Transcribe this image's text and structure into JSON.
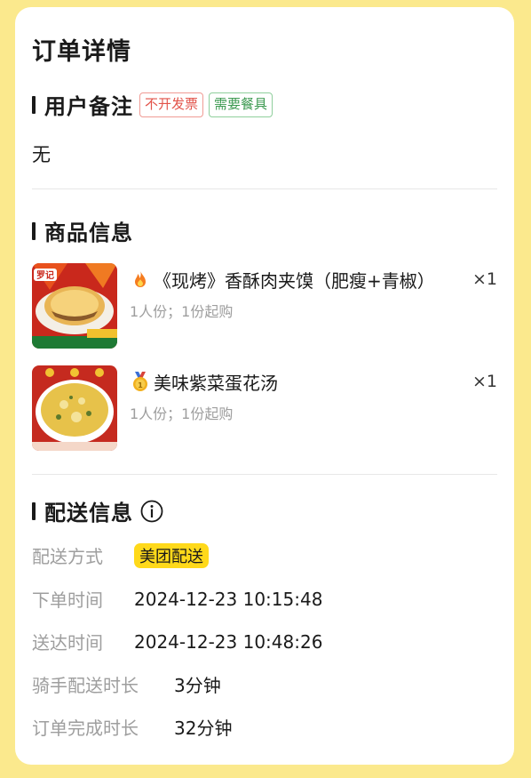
{
  "page": {
    "title": "订单详情"
  },
  "remark_section": {
    "title": "用户备注",
    "tags": [
      {
        "label": "不开发票",
        "color": "#e2534a"
      },
      {
        "label": "需要餐具",
        "color": "#3d9a51"
      }
    ],
    "content": "无"
  },
  "goods_section": {
    "title": "商品信息",
    "items": [
      {
        "icon": "fire-icon",
        "name": "《现烤》香酥肉夹馍（肥瘦+青椒）",
        "desc": "1人份；1份起购",
        "qty": "×1"
      },
      {
        "icon": "medal-icon",
        "name": "美味紫菜蛋花汤",
        "desc": "1人份；1份起购",
        "qty": "×1"
      }
    ]
  },
  "delivery_section": {
    "title": "配送信息",
    "info_icon": "info-circle-icon",
    "rows": [
      {
        "label": "配送方式",
        "value": "美团配送",
        "highlight": "#ffd91a"
      },
      {
        "label": "下单时间",
        "value": "2024-12-23 10:15:48"
      },
      {
        "label": "送达时间",
        "value": "2024-12-23 10:48:26"
      },
      {
        "label": "骑手配送时长",
        "value": "3分钟"
      },
      {
        "label": "订单完成时长",
        "value": "32分钟"
      }
    ]
  },
  "colors": {
    "background": "#fbe98d",
    "card": "#ffffff",
    "accent": "#ffd91a"
  }
}
